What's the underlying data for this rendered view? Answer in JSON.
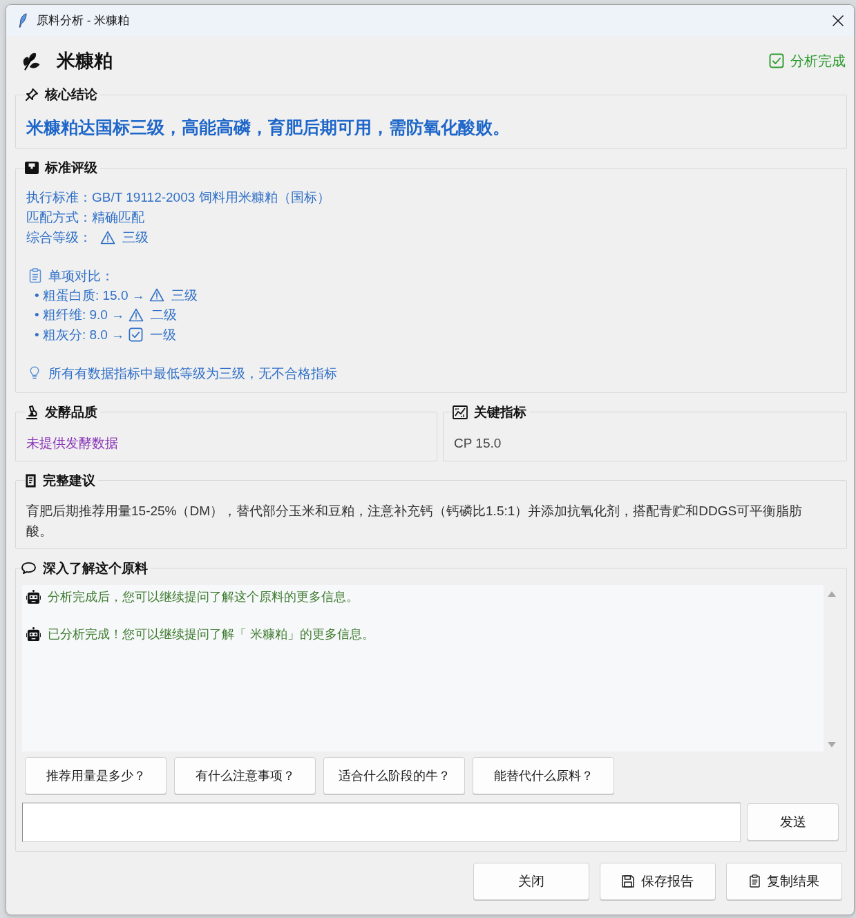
{
  "window": {
    "title": "原料分析 - 米糠粕"
  },
  "header": {
    "title": "米糠粕",
    "status": {
      "kind": "done",
      "label": "分析完成"
    }
  },
  "conclusion": {
    "heading": "核心结论",
    "text": "米糠粕达国标三级，高能高磷，育肥后期可用，需防氧化酸败。"
  },
  "grading": {
    "heading": "标准评级",
    "fields": [
      {
        "label": "执行标准：",
        "value": "GB/T 19112-2003 饲料用米糠粕（国标）",
        "kind": "plain"
      },
      {
        "label": "匹配方式：",
        "value": "精确匹配",
        "kind": "plain"
      },
      {
        "label": "综合等级：",
        "value": "三级",
        "kind": "warning"
      }
    ],
    "comparison": {
      "heading": "单项对比：",
      "items": [
        {
          "text": "• 粗蛋白质: 15.0 →",
          "kind": "warning",
          "grade": "三级"
        },
        {
          "text": "• 粗纤维: 9.0 →",
          "kind": "warning",
          "grade": "二级"
        },
        {
          "text": "• 粗灰分: 8.0 →",
          "kind": "pass",
          "grade": "一级"
        }
      ]
    },
    "note": "所有有数据指标中最低等级为三级，无不合格指标"
  },
  "fermentation": {
    "heading": "发酵品质",
    "text": "未提供发酵数据"
  },
  "key_metrics": {
    "heading": "关键指标",
    "text": "CP 15.0"
  },
  "advice": {
    "heading": "完整建议",
    "text": "育肥后期推荐用量15-25%（DM），替代部分玉米和豆粕，注意补充钙（钙磷比1.5:1）并添加抗氧化剂，搭配青贮和DDGS可平衡脂肪酸。"
  },
  "chat": {
    "heading": "深入了解这个原料",
    "messages": [
      "分析完成后，您可以继续提问了解这个原料的更多信息。",
      "已分析完成！您可以继续提问了解「 米糠粕」的更多信息。"
    ],
    "suggestions": [
      "推荐用量是多少？",
      "有什么注意事项？",
      "适合什么阶段的牛？",
      "能替代什么原料？"
    ],
    "send_button": "发送"
  },
  "footer": {
    "buttons": [
      {
        "label": "关闭",
        "kind": "plain"
      },
      {
        "label": "保存报告",
        "kind": "save"
      },
      {
        "label": "复制结果",
        "kind": "copy"
      }
    ]
  }
}
